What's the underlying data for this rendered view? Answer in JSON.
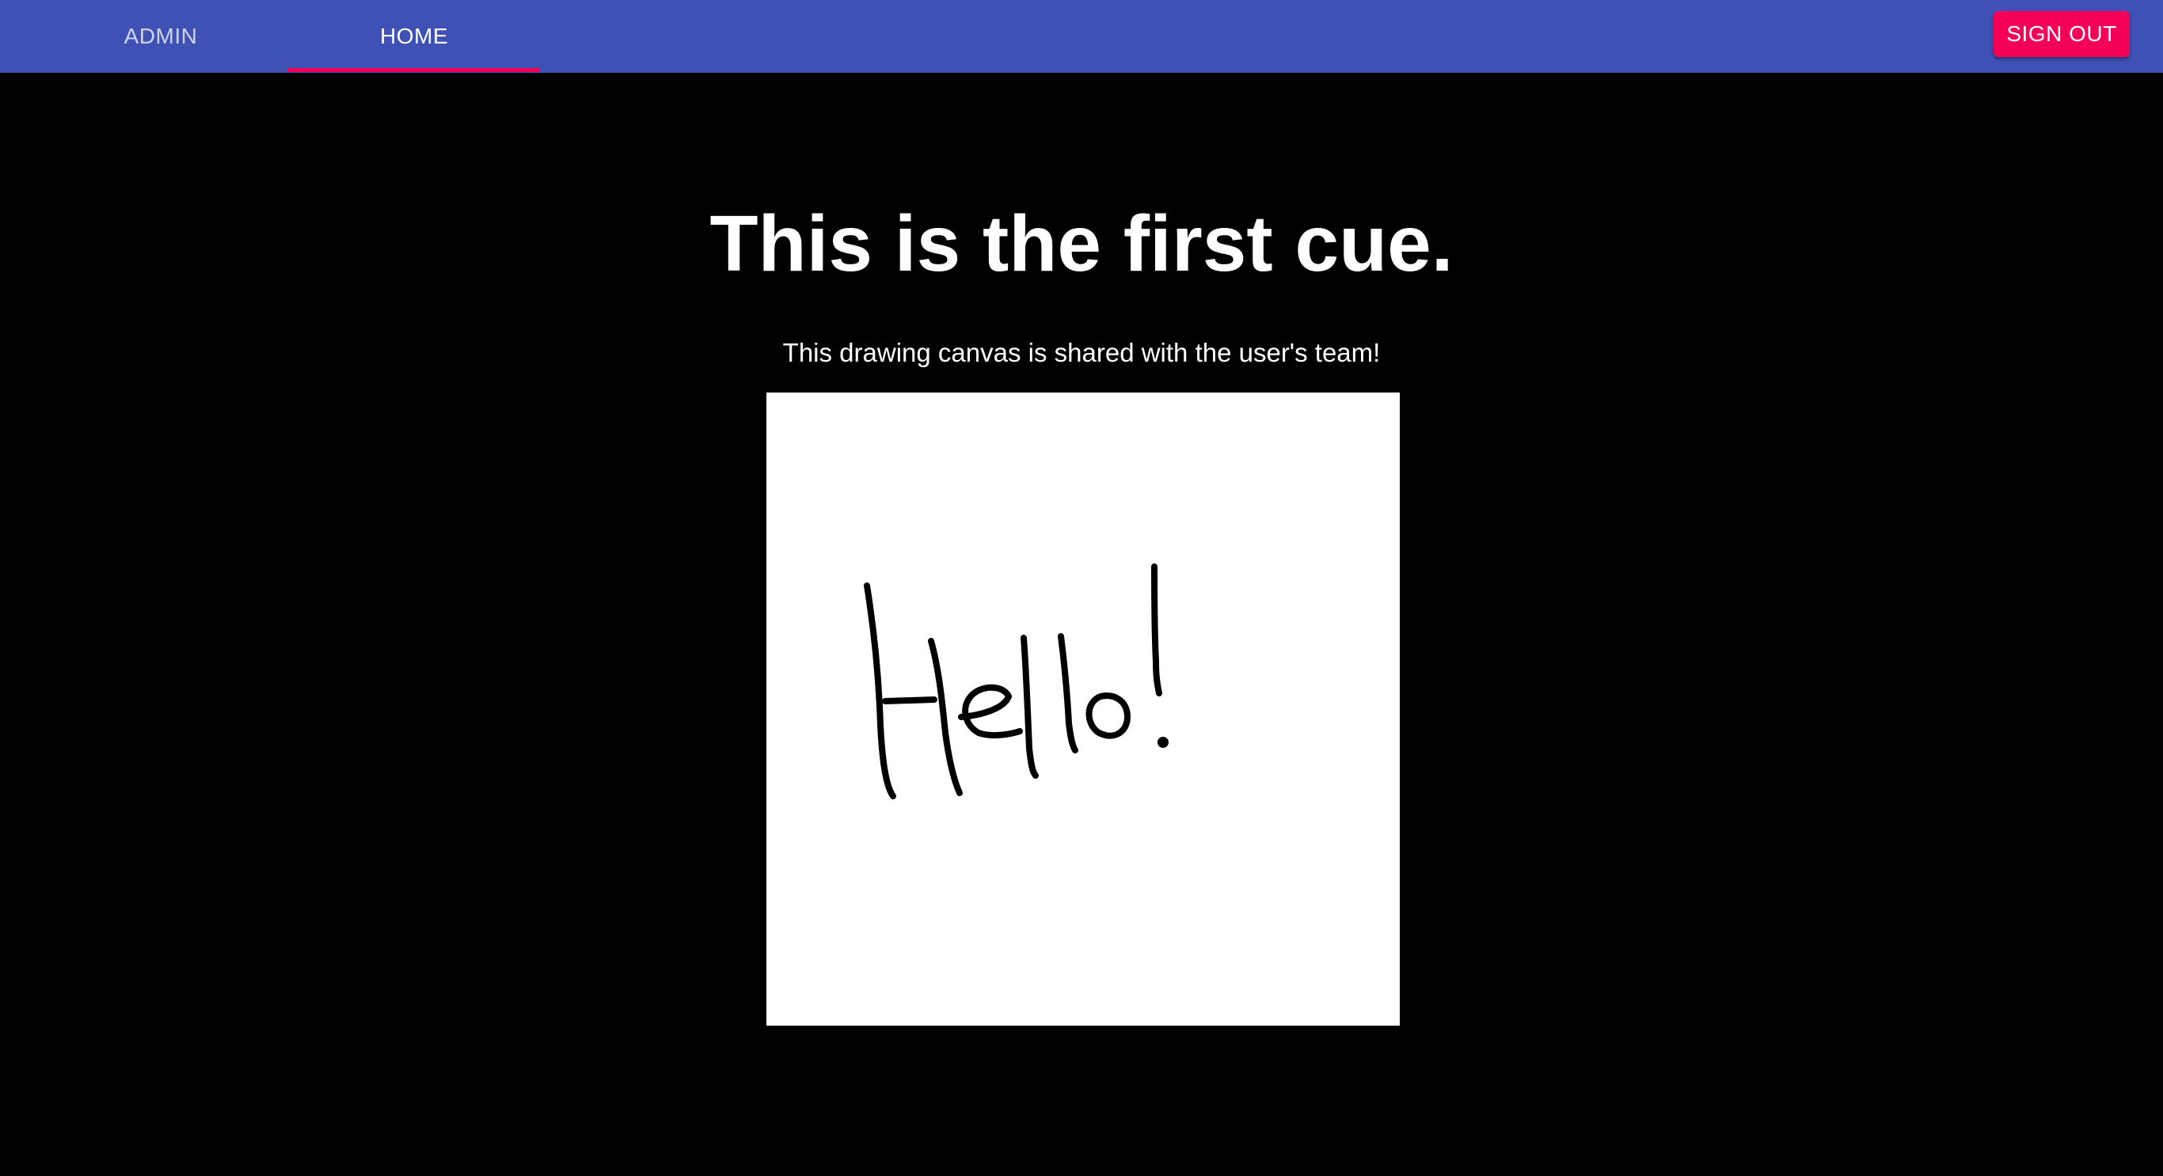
{
  "nav": {
    "tabs": [
      {
        "label": "ADMIN",
        "active": false
      },
      {
        "label": "HOME",
        "active": true
      }
    ],
    "sign_out_label": "SIGN OUT"
  },
  "colors": {
    "appbar": "#3f51b5",
    "accent": "#f50057",
    "page_background": "#000000",
    "canvas_background": "#ffffff",
    "ink": "#000000"
  },
  "cue": {
    "title": "This is the first cue.",
    "subtitle": "This drawing canvas is shared with the user's team!"
  }
}
